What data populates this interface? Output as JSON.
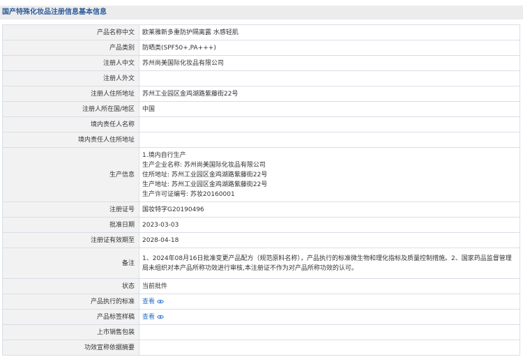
{
  "page": {
    "title": "国产特殊化妆品注册信息基本信息"
  },
  "rows": {
    "product_name_cn": {
      "label": "产品名称中文",
      "value": "欧莱雅新多重防护隔离露 水感轻肌"
    },
    "product_category": {
      "label": "产品类别",
      "value": "防晒类(SPF50+,PA+++)"
    },
    "registrant_cn": {
      "label": "注册人中文",
      "value": "苏州尚美国际化妆品有限公司"
    },
    "registrant_en": {
      "label": "注册人外文",
      "value": ""
    },
    "registrant_address": {
      "label": "注册人住所地址",
      "value": "苏州工业园区金鸡湖路紫藤街22号"
    },
    "registrant_region": {
      "label": "注册人所在国/地区",
      "value": "中国"
    },
    "domestic_rep_name": {
      "label": "境内责任人名称",
      "value": ""
    },
    "domestic_rep_address": {
      "label": "境内责任人住所地址",
      "value": ""
    },
    "production_info": {
      "label": "生产信息",
      "lines": [
        "1.境内自行生产",
        "生产企业名称:  苏州尚美国际化妆品有限公司",
        "住所地址:  苏州工业园区金鸡湖路紫藤街22号",
        "生产地址:  苏州工业园区金鸡湖路紫藤街22号",
        "生产许可证编号:  苏妆20160001"
      ]
    },
    "registration_no": {
      "label": "注册证号",
      "value": "国妆特字G20190496"
    },
    "approval_date": {
      "label": "批准日期",
      "value": "2023-03-03"
    },
    "valid_until": {
      "label": "注册证有效期至",
      "value": "2028-04-18"
    },
    "remarks": {
      "label": "备注",
      "value": "1、2024年08月16日批准变更产品配方（规范原料名称），产品执行的标准微生物和理化指标及质量控制措施。2、国家药品监督管理局未组织对本产品所称功效进行审核,本注册证不作为对产品所称功效的认可。"
    },
    "status": {
      "label": "状态",
      "value": "当前批件"
    },
    "product_standard": {
      "label": "产品执行的标准",
      "link": "查看",
      "icon": "eye-icon"
    },
    "label_sample": {
      "label": "产品标签样稿",
      "link": "查看",
      "icon": "eye-icon"
    },
    "market_packaging": {
      "label": "上市销售包装",
      "value": ""
    },
    "efficacy_basis": {
      "label": "功效宣称依据摘要",
      "value": ""
    }
  },
  "colors": {
    "title_text": "#2e5c9a",
    "label_bg": "#f2f2f2",
    "border": "#d8dee6",
    "link": "#2a72c8"
  }
}
